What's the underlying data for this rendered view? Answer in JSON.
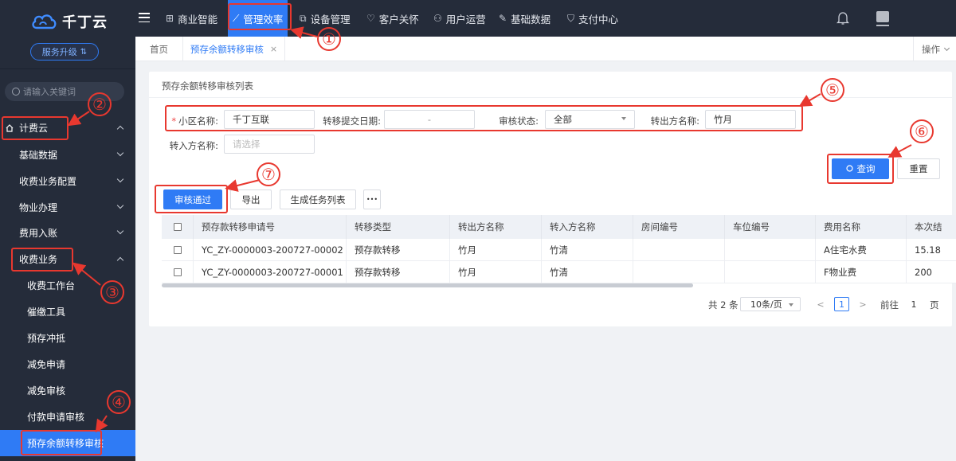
{
  "sidebar": {
    "logo_text": "千丁云",
    "upgrade_label": "服务升级",
    "search_placeholder": "请输入关键词",
    "items": [
      {
        "label": "计费云"
      },
      {
        "label": "基础数据"
      },
      {
        "label": "收费业务配置"
      },
      {
        "label": "物业办理"
      },
      {
        "label": "费用入账"
      },
      {
        "label": "收费业务"
      },
      {
        "label": "收费工作台"
      },
      {
        "label": "催缴工具"
      },
      {
        "label": "预存冲抵"
      },
      {
        "label": "减免申请"
      },
      {
        "label": "减免审核"
      },
      {
        "label": "付款申请审核"
      },
      {
        "label": "预存余额转移审核"
      }
    ]
  },
  "topnav": {
    "items": [
      {
        "label": "商业智能",
        "icon": "report-icon"
      },
      {
        "label": "管理效率",
        "icon": "trend-icon"
      },
      {
        "label": "设备管理",
        "icon": "device-icon"
      },
      {
        "label": "客户关怀",
        "icon": "heart-icon"
      },
      {
        "label": "用户运营",
        "icon": "user-ops-icon"
      },
      {
        "label": "基础数据",
        "icon": "wrench-icon"
      },
      {
        "label": "支付中心",
        "icon": "shield-icon"
      }
    ]
  },
  "tabs": {
    "home": "首页",
    "current": "预存余额转移审核",
    "close": "×",
    "ops": "操作"
  },
  "card": {
    "title": "预存余额转移审核列表"
  },
  "filters": {
    "required_mark": "*",
    "community_label": "小区名称:",
    "community_value": "千丁互联",
    "date_label": "转移提交日期:",
    "date_sep": "-",
    "status_label": "审核状态:",
    "status_value": "全部",
    "from_label": "转出方名称:",
    "from_value": "竹月",
    "to_label": "转入方名称:",
    "to_placeholder": "请选择"
  },
  "buttons": {
    "query": "查询",
    "reset": "重置",
    "approve": "审核通过",
    "export": "导出",
    "generate": "生成任务列表",
    "more": "•••"
  },
  "table": {
    "columns": [
      "预存款转移申请号",
      "转移类型",
      "转出方名称",
      "转入方名称",
      "房间编号",
      "车位编号",
      "费用名称",
      "本次结"
    ],
    "rows": [
      [
        "YC_ZY-0000003-200727-00002",
        "预存款转移",
        "竹月",
        "竹清",
        "",
        "",
        "A住宅水费",
        "15.18"
      ],
      [
        "YC_ZY-0000003-200727-00001",
        "预存款转移",
        "竹月",
        "竹清",
        "",
        "",
        "F物业费",
        "200"
      ]
    ]
  },
  "pager": {
    "total": "共 2 条",
    "page_size": "10条/页",
    "prev": "<",
    "current": "1",
    "next": ">",
    "goto_label": "前往",
    "goto_value": "1",
    "goto_suffix": "页"
  },
  "annotations": [
    "①",
    "②",
    "③",
    "④",
    "⑤",
    "⑥",
    "⑦"
  ],
  "colors": {
    "sidebar_bg": "#252c3a",
    "accent": "#2f7bf5",
    "annotation": "#e8382f"
  }
}
